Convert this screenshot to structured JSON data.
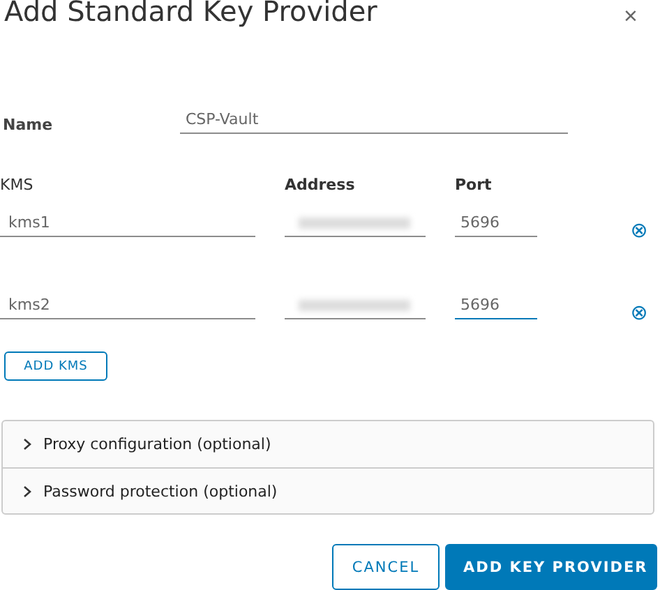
{
  "dialog": {
    "title": "Add Standard Key Provider",
    "close": "×"
  },
  "name_field": {
    "label": "Name",
    "value": "CSP-Vault"
  },
  "kms_table": {
    "columns": [
      "KMS",
      "Address",
      "Port"
    ],
    "rows": [
      {
        "kms": "kms1",
        "address": {
          "redacted": true
        },
        "port": "5696",
        "port_focused": false,
        "remove": "⊗"
      },
      {
        "kms": "kms2",
        "address": {
          "redacted": true
        },
        "port": "5696",
        "port_focused": true,
        "remove": "⊗"
      }
    ]
  },
  "add_kms_button": "ADD KMS",
  "sections": [
    {
      "label": "Proxy configuration (optional)",
      "expanded": false
    },
    {
      "label": "Password protection (optional)",
      "expanded": false
    }
  ],
  "buttons": [
    {
      "label": "CANCEL",
      "kind": "outline"
    },
    {
      "label": "ADD KEY PROVIDER",
      "kind": "primary"
    }
  ]
}
